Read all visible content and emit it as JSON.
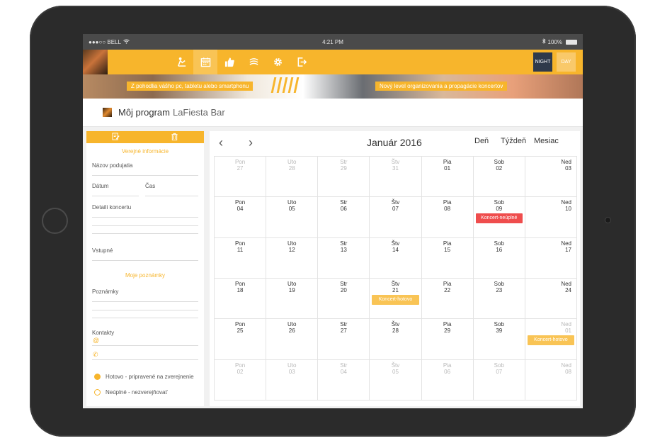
{
  "status_bar": {
    "carrier": "●●●○○ BELL",
    "time": "4:21 PM",
    "battery": "100%"
  },
  "nav_icons": [
    "rehearsal-icon",
    "calendar-icon",
    "thumbs-up-icon",
    "money-icon",
    "gear-icon",
    "logout-icon"
  ],
  "mode": {
    "night": "NIGHT",
    "day": "DAY"
  },
  "banner": {
    "left": "Z pohodlia vášho pc, tabletu alebo smartphonu",
    "right": "Nový level organizovania a propagácie koncertov"
  },
  "page_title": {
    "strong": "Môj program",
    "light": "LaFiesta Bar"
  },
  "form": {
    "public_section": "Verejné informácie",
    "event_name": "Názov podujatia",
    "date": "Dátum",
    "time": "Čas",
    "details": "Detaili koncertu",
    "entry": "Vstupné",
    "notes_section": "Moje poznámky",
    "notes": "Poznámky",
    "contacts": "Kontakty",
    "email_glyph": "@",
    "phone_glyph": "✆"
  },
  "legend": {
    "done": "Hotovo - pripravené na zverejnenie",
    "incomplete": "Neúplné - nezverejňovať"
  },
  "calendar": {
    "title": "Január 2016",
    "prev": "‹",
    "next": "›",
    "views": {
      "day": "Deň",
      "week": "Týždeň",
      "month": "Mesiac"
    },
    "colors": {
      "accent": "#f7b52c",
      "event_red": "#ef4d4d",
      "event_orange": "#f9c455"
    },
    "weeks": [
      [
        {
          "d": "Pon",
          "n": "27",
          "muted": true
        },
        {
          "d": "Uto",
          "n": "28",
          "muted": true
        },
        {
          "d": "Str",
          "n": "29",
          "muted": true
        },
        {
          "d": "Štv",
          "n": "31",
          "muted": true
        },
        {
          "d": "Pia",
          "n": "01"
        },
        {
          "d": "Sob",
          "n": "02"
        },
        {
          "d": "Ned",
          "n": "03",
          "right": true
        }
      ],
      [
        {
          "d": "Pon",
          "n": "04"
        },
        {
          "d": "Uto",
          "n": "05"
        },
        {
          "d": "Str",
          "n": "06"
        },
        {
          "d": "Štv",
          "n": "07"
        },
        {
          "d": "Pia",
          "n": "08"
        },
        {
          "d": "Sob",
          "n": "09",
          "event": {
            "label": "Koncert-neúplné",
            "color": "red"
          }
        },
        {
          "d": "Ned",
          "n": "10",
          "right": true
        }
      ],
      [
        {
          "d": "Pon",
          "n": "11"
        },
        {
          "d": "Uto",
          "n": "12"
        },
        {
          "d": "Str",
          "n": "13"
        },
        {
          "d": "Štv",
          "n": "14"
        },
        {
          "d": "Pia",
          "n": "15"
        },
        {
          "d": "Sob",
          "n": "16"
        },
        {
          "d": "Ned",
          "n": "17",
          "right": true
        }
      ],
      [
        {
          "d": "Pon",
          "n": "18"
        },
        {
          "d": "Uto",
          "n": "19"
        },
        {
          "d": "Str",
          "n": "20"
        },
        {
          "d": "Štv",
          "n": "21",
          "event": {
            "label": "Koncert-hotovo",
            "color": "orange"
          }
        },
        {
          "d": "Pia",
          "n": "22"
        },
        {
          "d": "Sob",
          "n": "23"
        },
        {
          "d": "Ned",
          "n": "24",
          "right": true
        }
      ],
      [
        {
          "d": "Pon",
          "n": "25"
        },
        {
          "d": "Uto",
          "n": "26"
        },
        {
          "d": "Str",
          "n": "27"
        },
        {
          "d": "Štv",
          "n": "28"
        },
        {
          "d": "Pia",
          "n": "29"
        },
        {
          "d": "Sob",
          "n": "39"
        },
        {
          "d": "Ned",
          "n": "01",
          "muted": true,
          "right": true,
          "event": {
            "label": "Koncert-hotovo",
            "color": "orange"
          }
        }
      ],
      [
        {
          "d": "Pon",
          "n": "02",
          "muted": true
        },
        {
          "d": "Uto",
          "n": "03",
          "muted": true
        },
        {
          "d": "Str",
          "n": "04",
          "muted": true
        },
        {
          "d": "Štv",
          "n": "05",
          "muted": true
        },
        {
          "d": "Pia",
          "n": "06",
          "muted": true
        },
        {
          "d": "Sob",
          "n": "07",
          "muted": true
        },
        {
          "d": "Ned",
          "n": "08",
          "muted": true,
          "right": true
        }
      ]
    ]
  }
}
